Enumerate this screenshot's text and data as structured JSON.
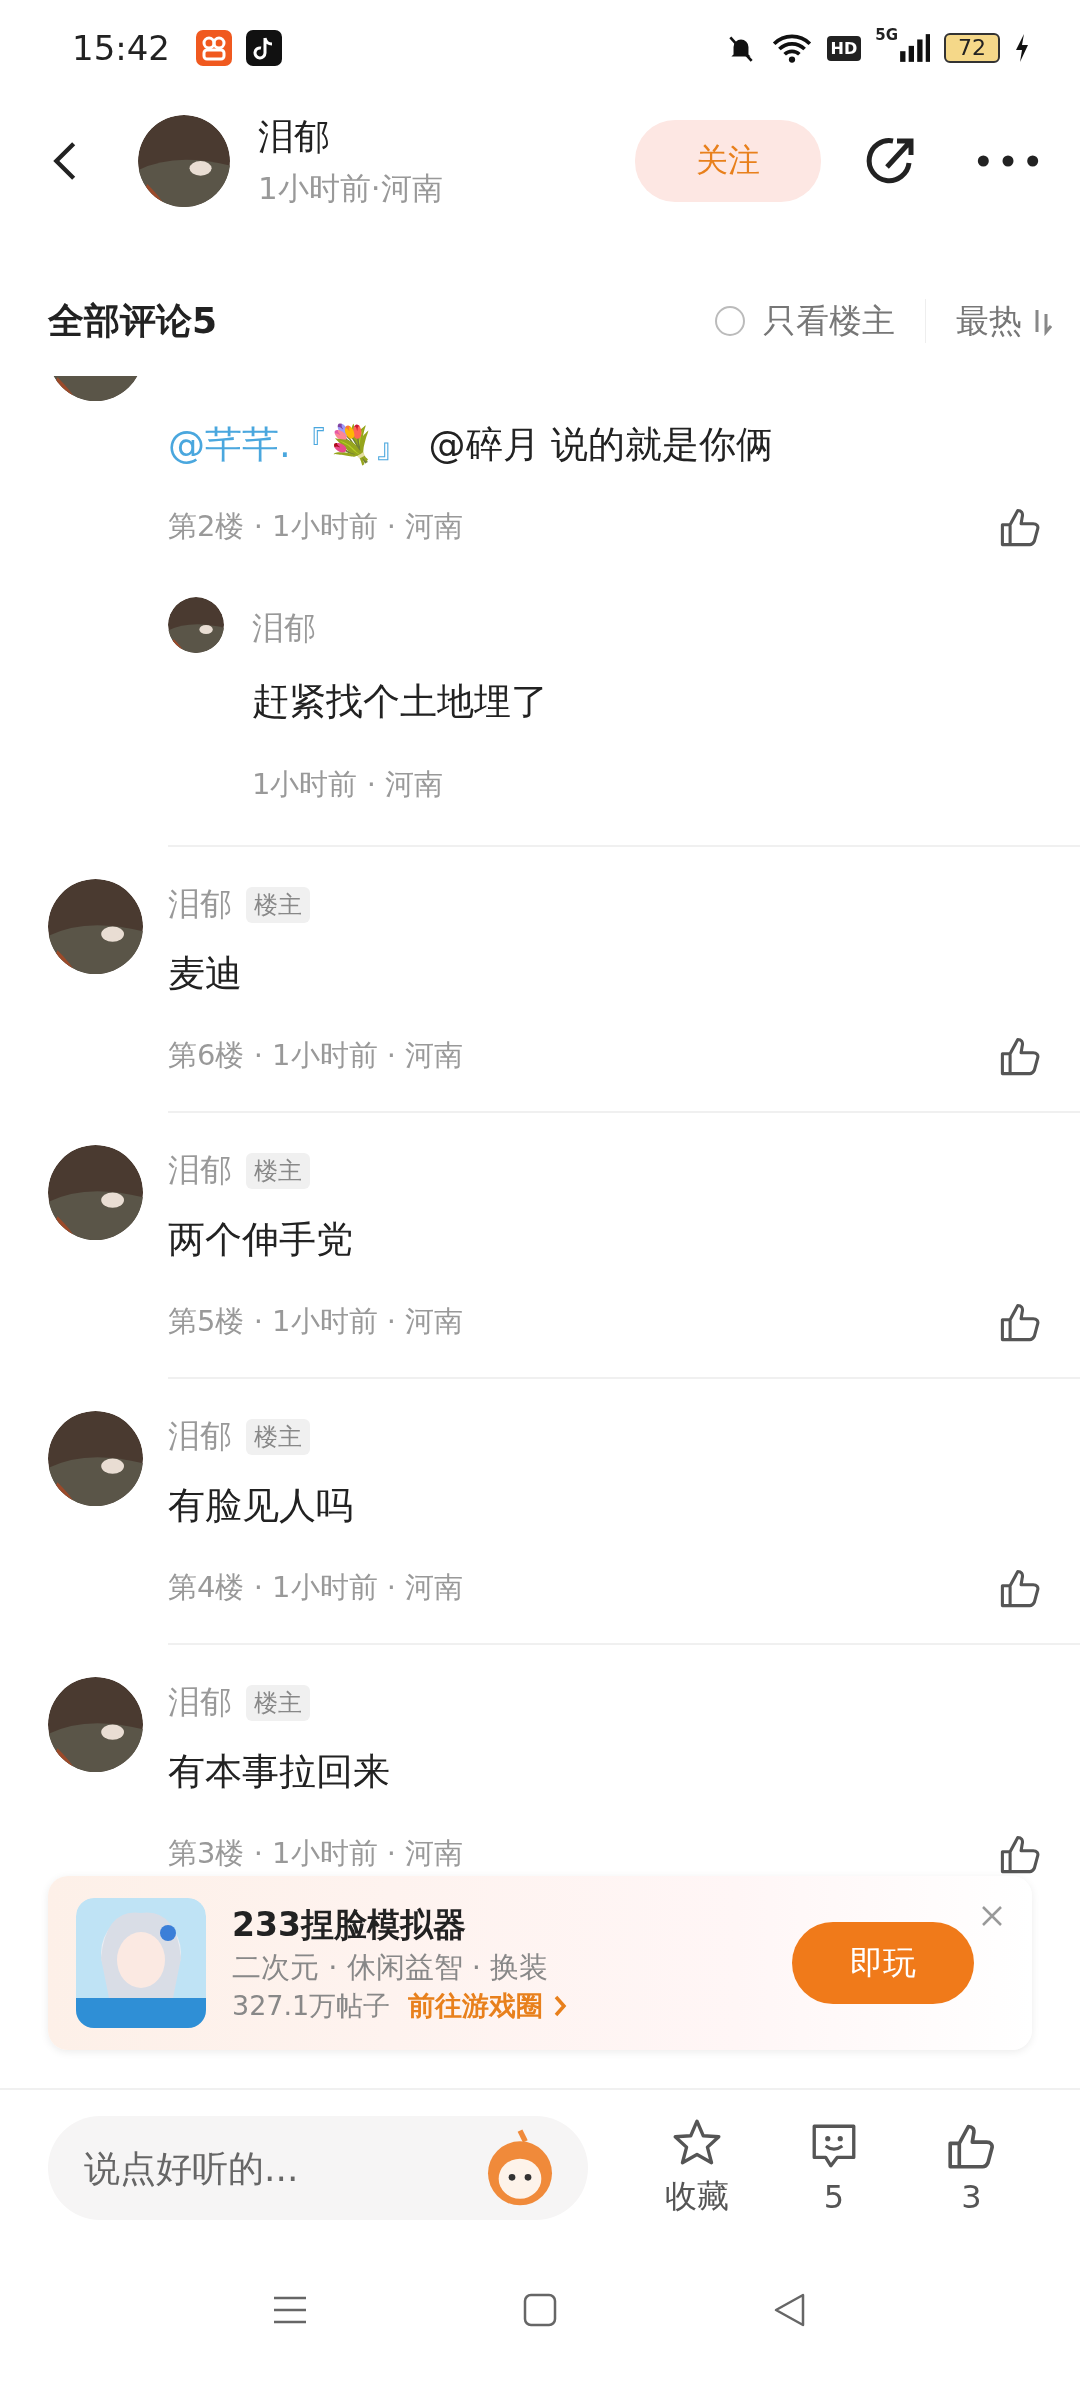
{
  "status_bar": {
    "time": "15:42",
    "network": "HD",
    "generation": "5G",
    "battery": "72"
  },
  "header": {
    "name": "泪郁",
    "subtitle": "1小时前·河南",
    "follow_button": "关注"
  },
  "comments_header": {
    "title": "全部评论5",
    "only_op": {
      "label": "只看楼主",
      "checked": false
    },
    "sort": "最热"
  },
  "comments": [
    {
      "segments": [
        {
          "kind": "mention",
          "text": "@芊芊.『💐』"
        },
        {
          "kind": "plain",
          "text": " @碎月 说的就是你俩"
        }
      ],
      "meta": "第2楼 · 1小时前 · 河南",
      "replies": [
        {
          "name": "泪郁",
          "text": "赶紧找个土地埋了",
          "meta": "1小时前 · 河南"
        }
      ]
    },
    {
      "name": "泪郁",
      "tag": "楼主",
      "segments": [
        {
          "kind": "plain",
          "text": "麦迪"
        }
      ],
      "meta": "第6楼 · 1小时前 · 河南"
    },
    {
      "name": "泪郁",
      "tag": "楼主",
      "segments": [
        {
          "kind": "plain",
          "text": "两个伸手党"
        }
      ],
      "meta": "第5楼 · 1小时前 · 河南"
    },
    {
      "name": "泪郁",
      "tag": "楼主",
      "segments": [
        {
          "kind": "plain",
          "text": "有脸见人吗"
        }
      ],
      "meta": "第4楼 · 1小时前 · 河南"
    },
    {
      "name": "泪郁",
      "tag": "楼主",
      "segments": [
        {
          "kind": "plain",
          "text": "有本事拉回来"
        }
      ],
      "meta": "第3楼 · 1小时前 · 河南"
    }
  ],
  "ad": {
    "kind": "picture",
    "title": "233捏脸模拟器",
    "tags": "二次元 · 休闲益智 · 换装",
    "posts": "327.1万帖子",
    "link": "前往游戏圈",
    "button": "即玩"
  },
  "bottom_bar": {
    "placeholder": "说点好听的...",
    "favorite": "收藏",
    "comments": "5",
    "likes": "3"
  }
}
